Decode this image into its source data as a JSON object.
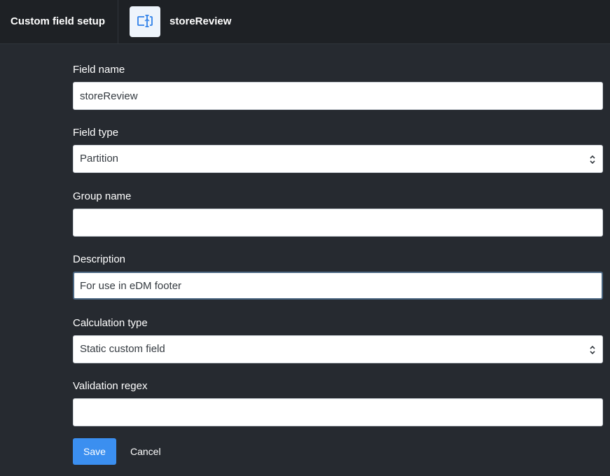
{
  "header": {
    "title": "Custom field setup",
    "field_icon": "custom-field-icon",
    "field_name": "storeReview"
  },
  "form": {
    "field_name": {
      "label": "Field name",
      "value": "storeReview"
    },
    "field_type": {
      "label": "Field type",
      "value": "Partition"
    },
    "group_name": {
      "label": "Group name",
      "value": ""
    },
    "description": {
      "label": "Description",
      "value": "For use in eDM footer"
    },
    "calculation_type": {
      "label": "Calculation type",
      "value": "Static custom field"
    },
    "validation_regex": {
      "label": "Validation regex",
      "value": ""
    }
  },
  "actions": {
    "save_label": "Save",
    "cancel_label": "Cancel"
  },
  "colors": {
    "background": "#262a30",
    "header_background": "#1e2125",
    "accent": "#3b8ff0",
    "icon_blue": "#2f80e8"
  }
}
